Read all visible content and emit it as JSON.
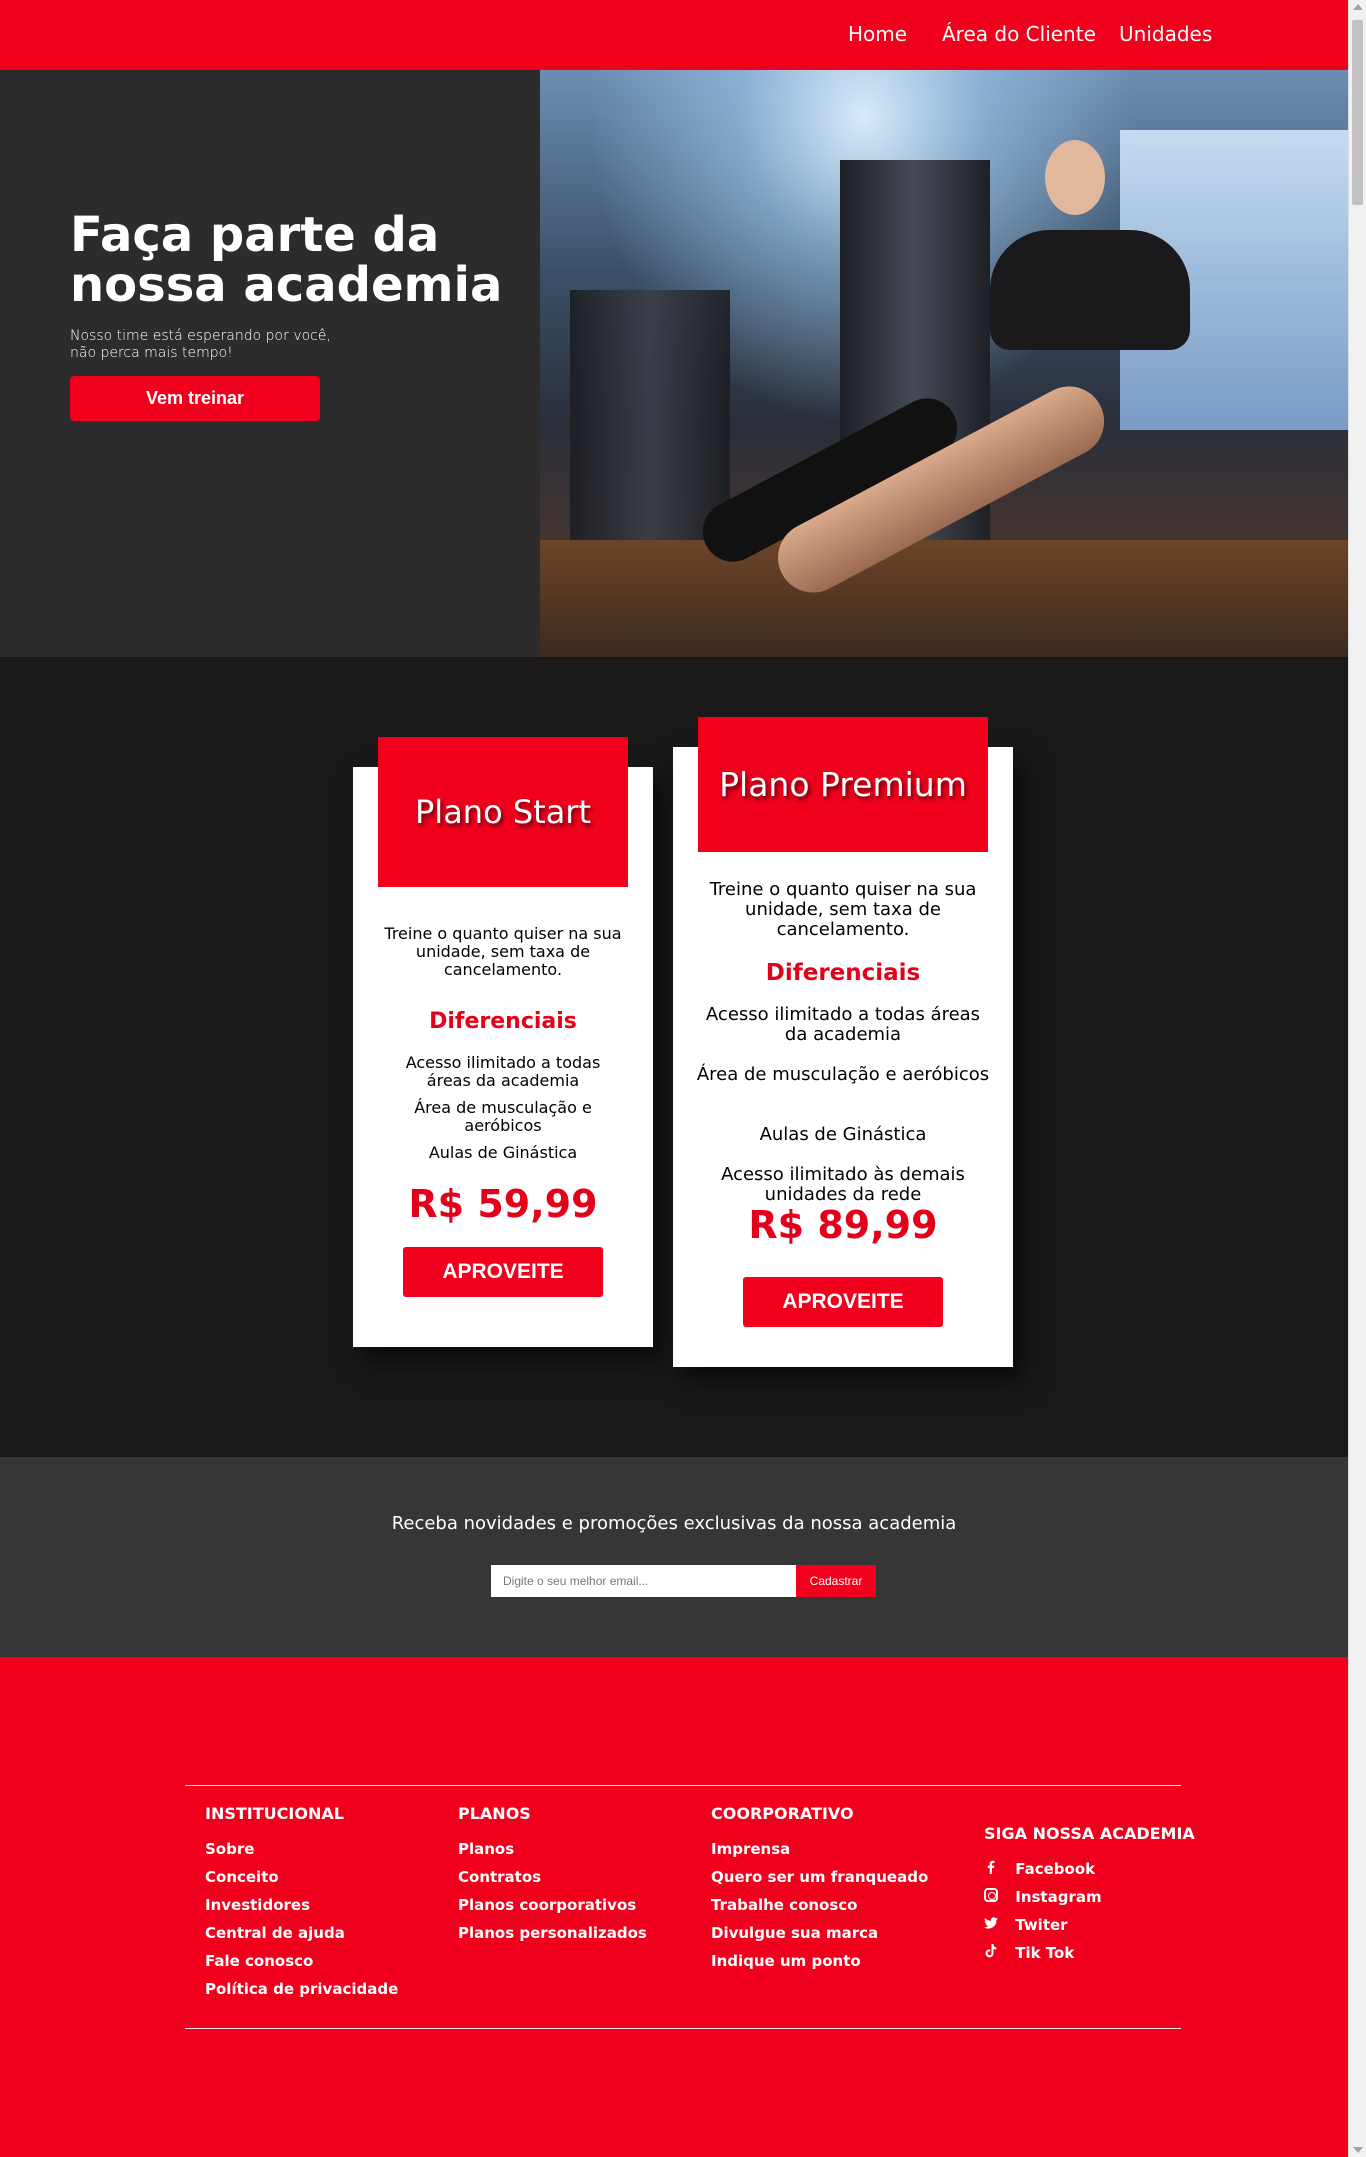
{
  "nav": {
    "home": "Home",
    "client_area": "Área do Cliente",
    "units": "Unidades"
  },
  "hero": {
    "title": "Faça parte da nossa academia",
    "subtitle_line1": "Nosso time está esperando por você,",
    "subtitle_line2": "não perca mais tempo!",
    "cta": "Vem treinar"
  },
  "plans": {
    "start": {
      "name": "Plano Start",
      "description": "Treine o quanto quiser na sua unidade, sem taxa de cancelamento.",
      "differentials_title": "Diferenciais",
      "features": [
        "Acesso ilimitado a todas áreas da academia",
        "Área de musculação e aeróbicos",
        "Aulas de Ginástica"
      ],
      "price": "R$ 59,99",
      "cta": "APROVEITE"
    },
    "premium": {
      "name": "Plano Premium",
      "description": "Treine o quanto quiser na sua unidade, sem taxa de cancelamento.",
      "differentials_title": "Diferenciais",
      "features": [
        "Acesso ilimitado a todas áreas da academia",
        "Área de musculação e aeróbicos",
        "Aulas de Ginástica",
        "Acesso ilimitado às demais unidades da rede"
      ],
      "price": "R$ 89,99",
      "cta": "APROVEITE"
    }
  },
  "newsletter": {
    "text": "Receba novidades e promoções exclusivas da nossa academia",
    "placeholder": "Digite o seu melhor email...",
    "button": "Cadastrar"
  },
  "footer": {
    "institutional": {
      "title": "INSTITUCIONAL",
      "links": [
        "Sobre",
        "Conceito",
        "Investidores",
        "Central de ajuda",
        "Fale conosco",
        "Política de privacidade"
      ]
    },
    "plans": {
      "title": "PLANOS",
      "links": [
        "Planos",
        "Contratos",
        "Planos coorporativos",
        "Planos personalizados"
      ]
    },
    "corporate": {
      "title": "COORPORATIVO",
      "links": [
        "Imprensa",
        "Quero ser um franqueado",
        "Trabalhe conosco",
        "Divulgue sua marca",
        "Indique um ponto"
      ]
    },
    "social": {
      "title": "SIGA NOSSA ACADEMIA",
      "links": [
        {
          "label": "Facebook",
          "icon": "facebook-icon"
        },
        {
          "label": "Instagram",
          "icon": "instagram-icon"
        },
        {
          "label": "Twiter",
          "icon": "twitter-icon"
        },
        {
          "label": "Tik Tok",
          "icon": "tiktok-icon"
        }
      ]
    }
  },
  "colors": {
    "brand_red": "#f0001c",
    "hero_bg": "#2d2b2c",
    "plans_bg": "#1a1819",
    "newsletter_bg": "#363636"
  }
}
